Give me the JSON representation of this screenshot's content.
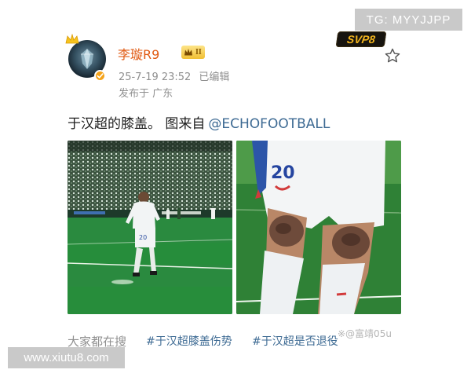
{
  "watermarks": {
    "telegram": "TG: MYYJJPP",
    "brand_logo": "SVP8",
    "site_url": "www.xiutu8.com",
    "corner_id": "※@富靖05u"
  },
  "post": {
    "author": {
      "name": "李璇R9",
      "level_badge": "II",
      "avatar_icon": "crystal-avatar",
      "verified_color": "#f4a31a"
    },
    "meta": {
      "timestamp": "25-7-19 23:52",
      "edited": "已编辑",
      "location": "发布于 广东"
    },
    "text": {
      "body": "于汉超的膝盖。 图来自",
      "mention": "@ECHOFOOTBALL"
    },
    "images": [
      {
        "icon": "football-player-photo"
      },
      {
        "icon": "bruised-knees-photo"
      }
    ],
    "trending": {
      "label": "大家都在搜",
      "tags": [
        "#于汉超膝盖伤势",
        "#于汉超是否退役"
      ]
    }
  },
  "colors": {
    "username": "#e05a12",
    "link": "#3d6a93",
    "meta_gray": "#8f8f8f",
    "badge_gold": "#f1bf34"
  }
}
